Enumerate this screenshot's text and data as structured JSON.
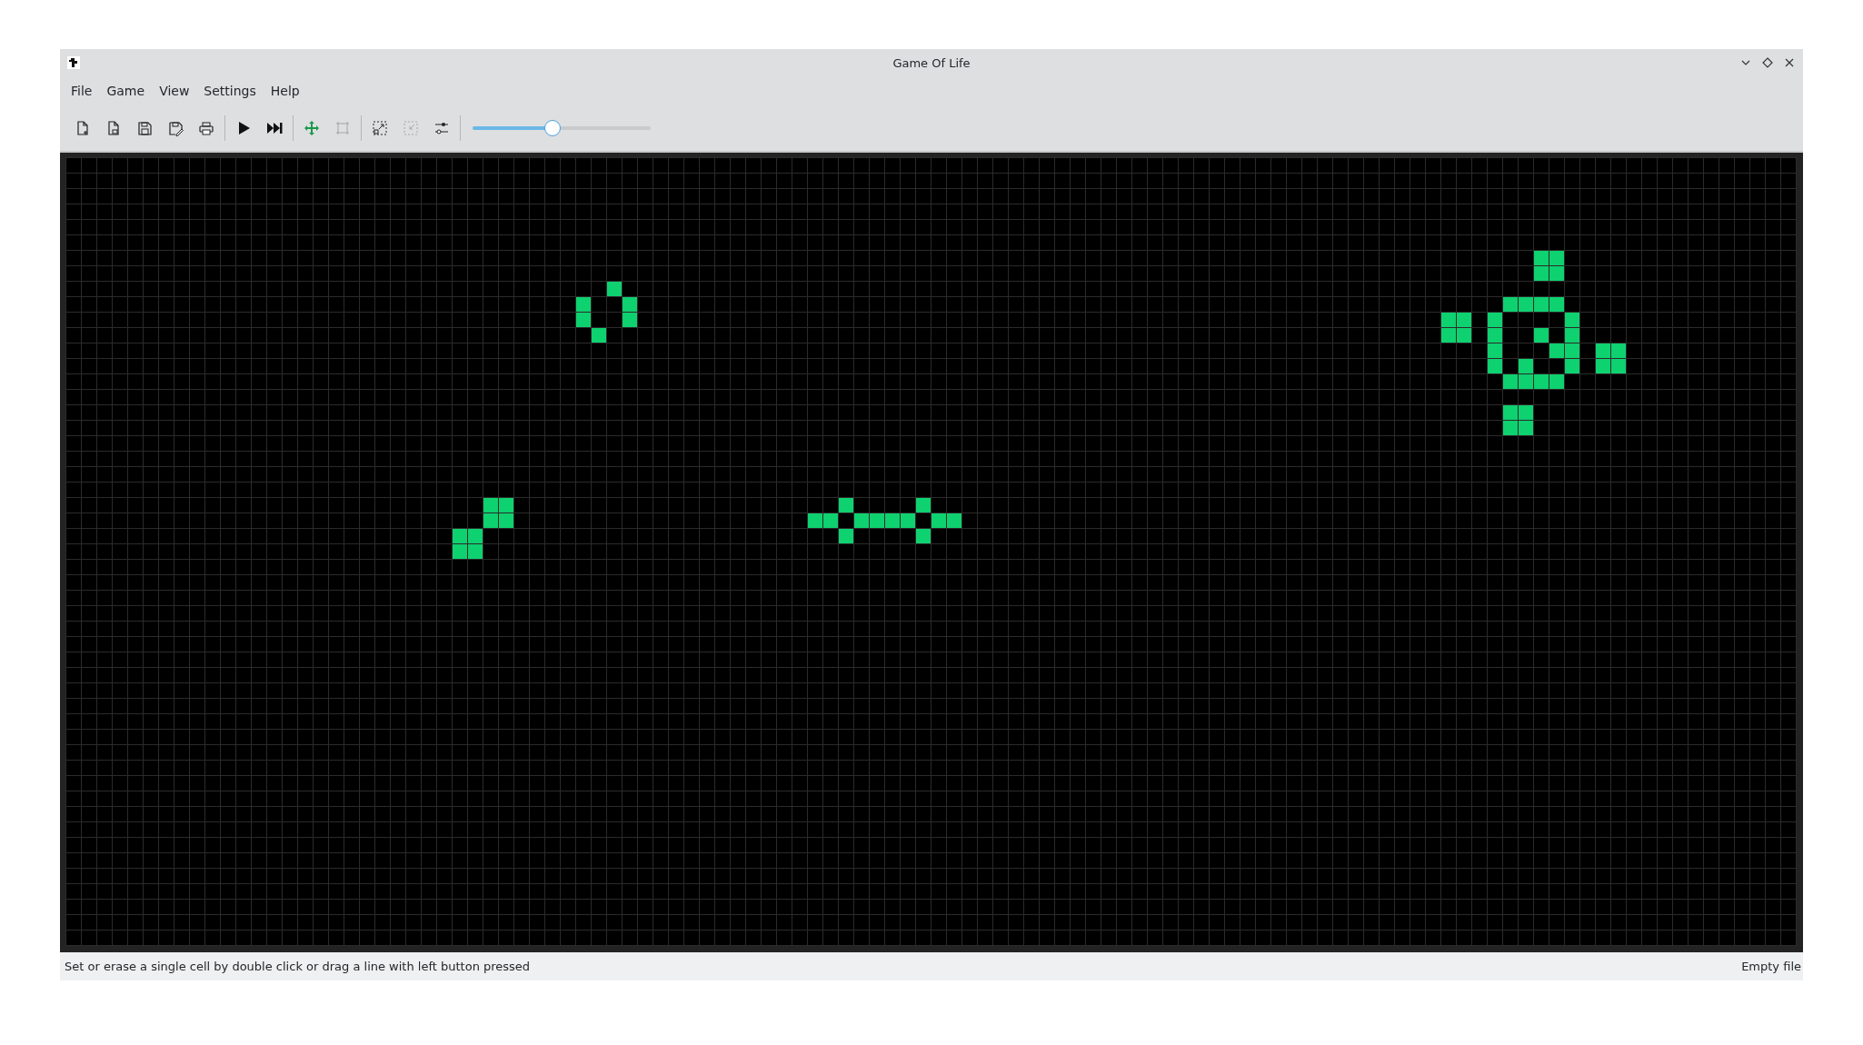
{
  "window": {
    "title": "Game Of Life"
  },
  "menu": [
    "File",
    "Game",
    "View",
    "Settings",
    "Help"
  ],
  "toolbar": [
    [
      {
        "disabled": false
      },
      {
        "disabled": false
      },
      {
        "disabled": false
      },
      {
        "disabled": false
      },
      {
        "disabled": false
      }
    ],
    [
      {
        "disabled": false
      },
      {
        "disabled": false
      }
    ],
    [
      {
        "disabled": false
      },
      {
        "disabled": true
      }
    ],
    [
      {
        "disabled": false
      },
      {
        "disabled": true
      },
      {
        "disabled": false
      }
    ]
  ],
  "speed_slider": {
    "level": 0.45
  },
  "status_bar": {
    "message": "Set or erase a single cell by double click or drag a line with left button pressed",
    "file": "Empty file"
  }
}
